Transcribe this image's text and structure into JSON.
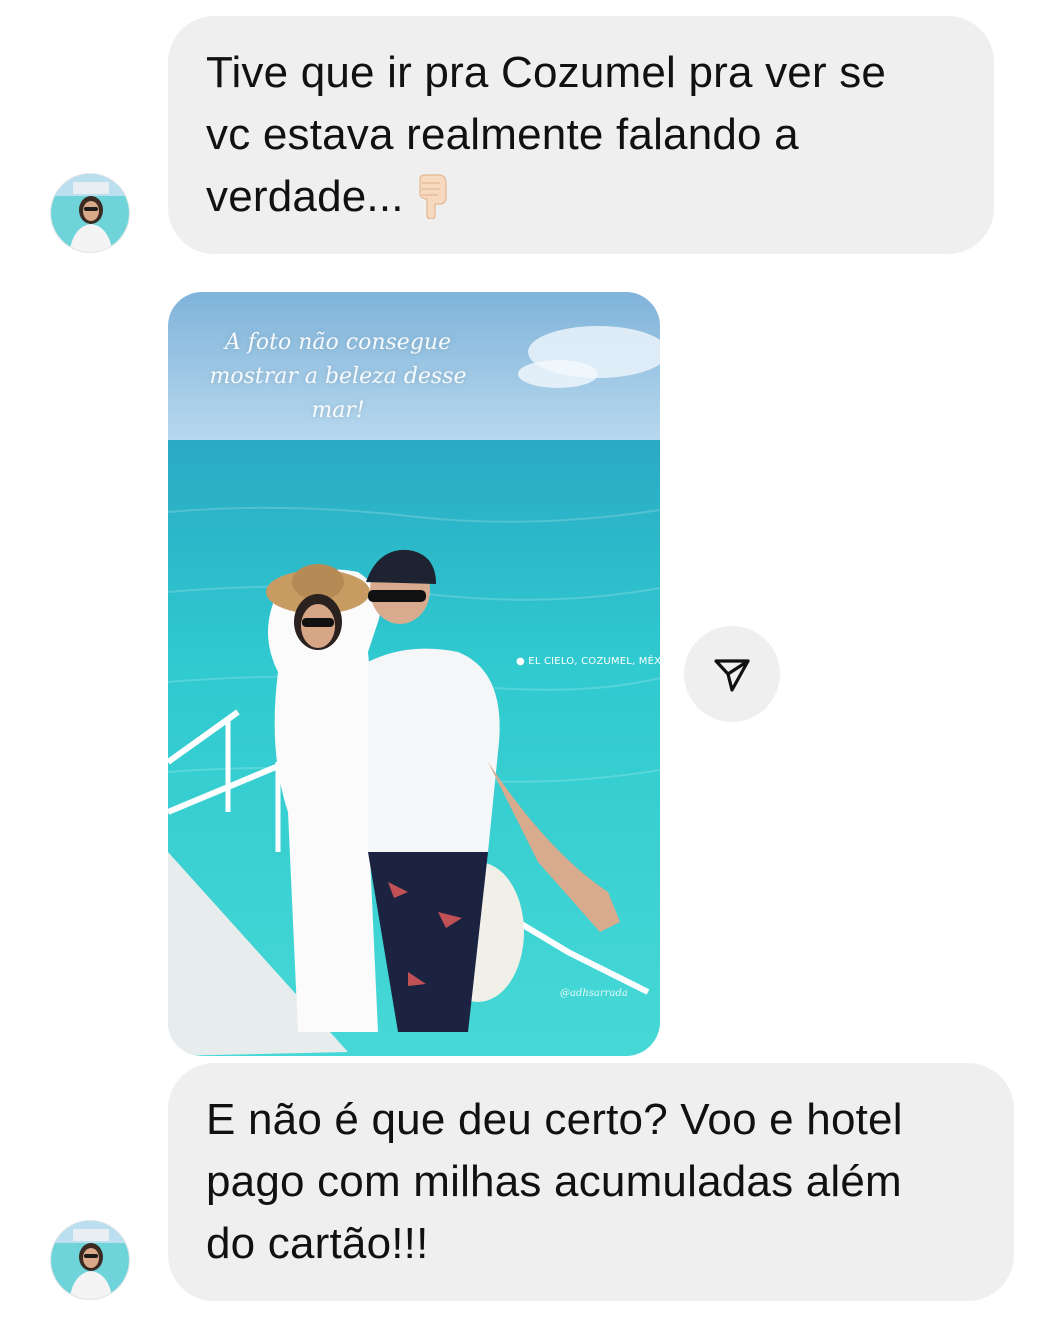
{
  "messages": [
    {
      "type": "text",
      "lines": [
        "Tive que ir pra Cozumel pra ver se",
        "vc estava realmente falando a",
        "verdade..."
      ],
      "emoji": "backhand-index-pointing-down"
    },
    {
      "type": "story_reply",
      "caption_lines": [
        "A foto não consegue",
        "mostrar a beleza desse",
        "mar!"
      ],
      "location_sticker": "● EL CIELO, COZUMEL, MÉXICO",
      "photo_handle": "@adhsarrada",
      "share_icon": "paper-plane-icon"
    },
    {
      "type": "text",
      "lines": [
        "E não é que deu certo? Voo e hotel",
        "pago com milhas acumuladas além",
        "do cartão!!!"
      ]
    }
  ],
  "colors": {
    "bubble_bg": "#efefef",
    "text": "#111111",
    "sea": "#2fc9cf",
    "sky": "#9fcbe6"
  }
}
